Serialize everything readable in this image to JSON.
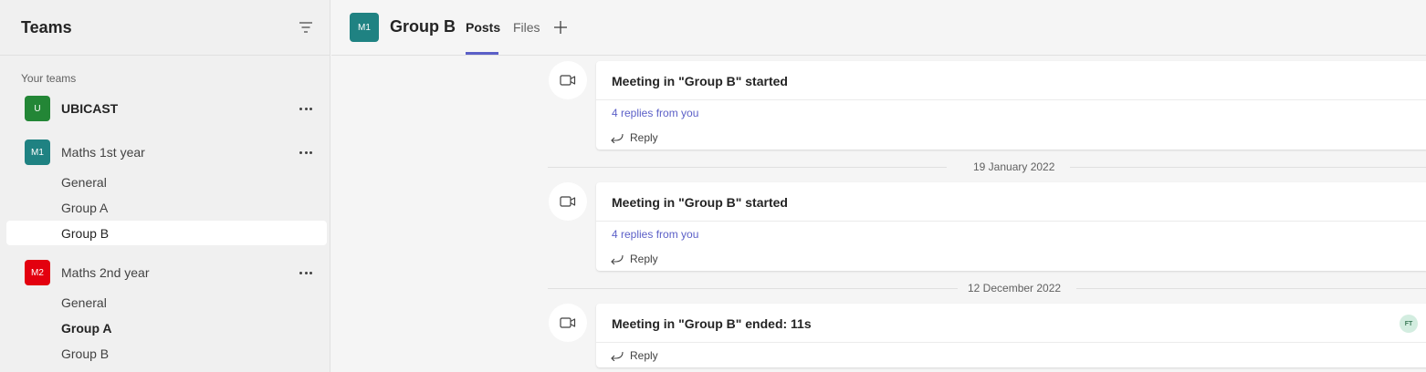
{
  "sidebar": {
    "title": "Teams",
    "section_label": "Your teams",
    "teams": [
      {
        "initials": "U",
        "name": "UBICAST",
        "color": "#238636",
        "bold": true,
        "channels": []
      },
      {
        "initials": "M1",
        "name": "Maths 1st year",
        "color": "#1f8282",
        "bold": false,
        "channels": [
          {
            "label": "General"
          },
          {
            "label": "Group A"
          },
          {
            "label": "Group B",
            "selected": true
          }
        ]
      },
      {
        "initials": "M2",
        "name": "Maths 2nd year",
        "color": "#e3000f",
        "bold": false,
        "channels": [
          {
            "label": "General"
          },
          {
            "label": "Group A",
            "bold": true
          },
          {
            "label": "Group B"
          }
        ]
      }
    ]
  },
  "header": {
    "avatar_initials": "M1",
    "channel_title": "Group B",
    "tabs": [
      {
        "label": "Posts",
        "active": true
      },
      {
        "label": "Files",
        "active": false
      }
    ]
  },
  "feed": {
    "posts": [
      {
        "title": "Meeting in \"Group B\" started",
        "replies": "4 replies from you",
        "reply_label": "Reply"
      },
      {
        "date": "19 January 2022",
        "title": "Meeting in \"Group B\" started",
        "replies": "4 replies from you",
        "reply_label": "Reply"
      },
      {
        "date": "12 December 2022",
        "title": "Meeting in \"Group B\" ended: 11s",
        "participant_initials": "FT",
        "reply_label": "Reply"
      }
    ]
  },
  "colors": {
    "accent": "#5b5fc7",
    "sidebar_bg": "#f0f0f0",
    "feed_bg": "#f5f5f5"
  }
}
